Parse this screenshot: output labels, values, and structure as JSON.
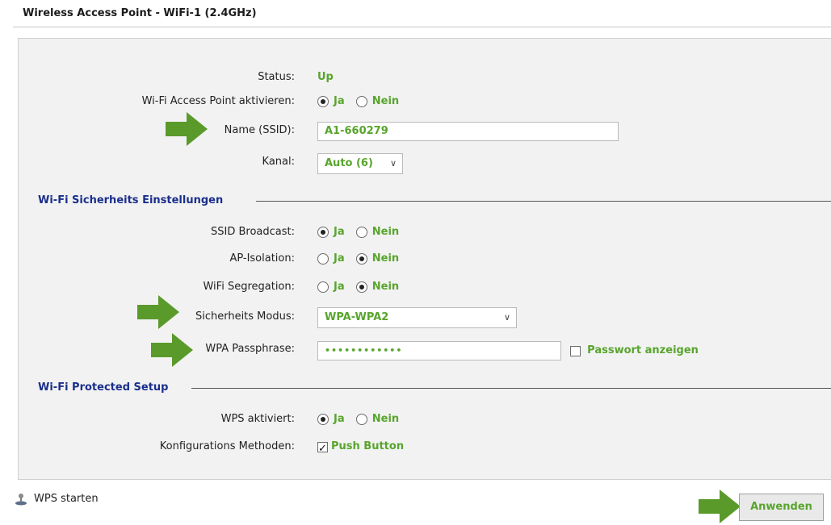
{
  "title": "Wireless Access Point - WiFi-1 (2.4GHz)",
  "status": {
    "label": "Status:",
    "value": "Up"
  },
  "ap_enable": {
    "label": "Wi-Fi Access Point aktivieren:",
    "options": [
      "Ja",
      "Nein"
    ],
    "selected": "Ja"
  },
  "ssid": {
    "label": "Name (SSID):",
    "value": "A1-660279"
  },
  "channel": {
    "label": "Kanal:",
    "value": "Auto (6)"
  },
  "security_section": {
    "title": "Wi-Fi Sicherheits Einstellungen"
  },
  "ssid_broadcast": {
    "label": "SSID Broadcast:",
    "options": [
      "Ja",
      "Nein"
    ],
    "selected": "Ja"
  },
  "ap_isolation": {
    "label": "AP-Isolation:",
    "options": [
      "Ja",
      "Nein"
    ],
    "selected": "Nein"
  },
  "wifi_segregation": {
    "label": "WiFi Segregation:",
    "options": [
      "Ja",
      "Nein"
    ],
    "selected": "Nein"
  },
  "security_mode": {
    "label": "Sicherheits Modus:",
    "value": "WPA-WPA2"
  },
  "passphrase": {
    "label": "WPA Passphrase:",
    "value": "••••••••••••",
    "show_label": "Passwort anzeigen",
    "show_checked": false
  },
  "wps_section": {
    "title": "Wi-Fi Protected Setup"
  },
  "wps_enabled": {
    "label": "WPS aktiviert:",
    "options": [
      "Ja",
      "Nein"
    ],
    "selected": "Ja"
  },
  "config_methods": {
    "label": "Konfigurations Methoden:",
    "option_label": "Push Button",
    "checked": true
  },
  "footer": {
    "wps_start_label": "WPS starten",
    "apply_label": "Anwenden"
  },
  "colors": {
    "accent_green": "#58a52d",
    "section_blue": "#1a2f8c",
    "arrow_green": "#5a9a2b"
  }
}
